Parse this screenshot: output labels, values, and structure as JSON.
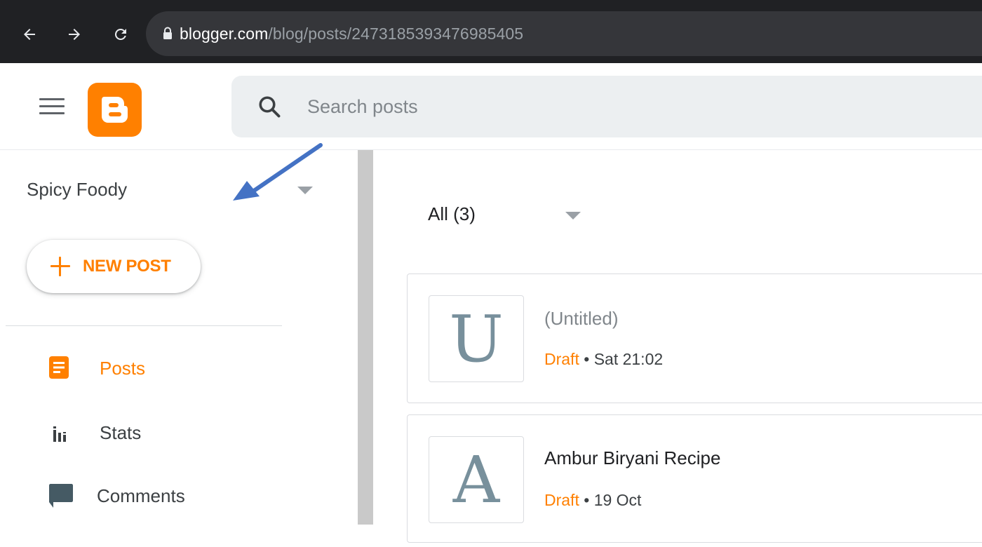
{
  "browser": {
    "url_host": "blogger.com",
    "url_path": "/blog/posts/2473185393476985405"
  },
  "header": {
    "search_placeholder": "Search posts"
  },
  "sidebar": {
    "blog_name": "Spicy Foody",
    "new_post_label": "NEW POST",
    "items": [
      {
        "label": "Posts",
        "icon": "posts-icon",
        "active": true
      },
      {
        "label": "Stats",
        "icon": "stats-icon",
        "active": false
      },
      {
        "label": "Comments",
        "icon": "comments-icon",
        "active": false
      }
    ]
  },
  "main": {
    "filter_label": "All (3)",
    "posts": [
      {
        "thumb_letter": "U",
        "title": "(Untitled)",
        "status": "Draft",
        "separator": "•",
        "date": "Sat 21:02"
      },
      {
        "thumb_letter": "A",
        "title": "Ambur Biryani Recipe",
        "status": "Draft",
        "separator": "•",
        "date": "19 Oct"
      }
    ]
  },
  "colors": {
    "accent": "#ff8000",
    "browser_bar": "#202124",
    "search_bg": "#eceff1",
    "annotation_arrow": "#4472c4"
  }
}
